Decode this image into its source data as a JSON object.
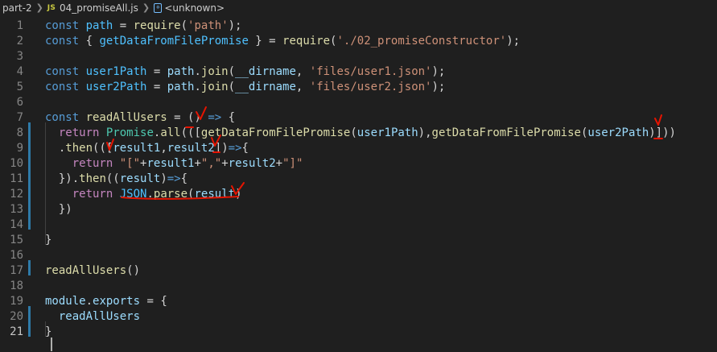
{
  "breadcrumb": {
    "folder": "part-2",
    "file_badge": "JS",
    "file": "04_promiseAll.js",
    "symbol": "<unknown>",
    "symbol_icon": "symbol-object-icon",
    "file_icon": "javascript-file-icon"
  },
  "colors": {
    "background": "#1f1f1f",
    "keyword": "#569cd6",
    "control": "#c586c0",
    "variable": "#9cdcfe",
    "function": "#dcdcaa",
    "string": "#ce9178",
    "class": "#4ec9b0",
    "annotation": "#e51400",
    "modified_bar": "#2e7aa8"
  },
  "editor": {
    "active_line": 21,
    "lines": [
      {
        "n": "1",
        "tokens": [
          [
            "kw",
            "const "
          ],
          [
            "const",
            "path"
          ],
          [
            "pl",
            " = "
          ],
          [
            "fn",
            "require"
          ],
          [
            "pl",
            "("
          ],
          [
            "str",
            "'path'"
          ],
          [
            "pl",
            ");"
          ]
        ]
      },
      {
        "n": "2",
        "tokens": [
          [
            "kw",
            "const "
          ],
          [
            "pl",
            "{ "
          ],
          [
            "const",
            "getDataFromFilePromise"
          ],
          [
            "pl",
            " } = "
          ],
          [
            "fn",
            "require"
          ],
          [
            "pl",
            "("
          ],
          [
            "str",
            "'./02_promiseConstructor'"
          ],
          [
            "pl",
            ");"
          ]
        ]
      },
      {
        "n": "3",
        "tokens": []
      },
      {
        "n": "4",
        "tokens": [
          [
            "kw",
            "const "
          ],
          [
            "const",
            "user1Path"
          ],
          [
            "pl",
            " = "
          ],
          [
            "var",
            "path"
          ],
          [
            "pl",
            "."
          ],
          [
            "fn",
            "join"
          ],
          [
            "pl",
            "("
          ],
          [
            "var",
            "__dirname"
          ],
          [
            "pl",
            ", "
          ],
          [
            "str",
            "'files/user1.json'"
          ],
          [
            "pl",
            ");"
          ]
        ]
      },
      {
        "n": "5",
        "tokens": [
          [
            "kw",
            "const "
          ],
          [
            "const",
            "user2Path"
          ],
          [
            "pl",
            " = "
          ],
          [
            "var",
            "path"
          ],
          [
            "pl",
            "."
          ],
          [
            "fn",
            "join"
          ],
          [
            "pl",
            "("
          ],
          [
            "var",
            "__dirname"
          ],
          [
            "pl",
            ", "
          ],
          [
            "str",
            "'files/user2.json'"
          ],
          [
            "pl",
            ");"
          ]
        ]
      },
      {
        "n": "6",
        "tokens": []
      },
      {
        "n": "7",
        "tokens": [
          [
            "kw",
            "const "
          ],
          [
            "fn",
            "readAllUsers"
          ],
          [
            "pl",
            " = () "
          ],
          [
            "kw",
            "=>"
          ],
          [
            "pl",
            " {"
          ]
        ]
      },
      {
        "n": "8",
        "tokens": [
          [
            "pl",
            "  "
          ],
          [
            "ctl",
            "return "
          ],
          [
            "cls",
            "Promise"
          ],
          [
            "pl",
            "."
          ],
          [
            "fn",
            "all"
          ],
          [
            "pl",
            "((["
          ],
          [
            "fn",
            "getDataFromFilePromise"
          ],
          [
            "pl",
            "("
          ],
          [
            "var",
            "user1Path"
          ],
          [
            "pl",
            "),"
          ],
          [
            "fn",
            "getDataFromFilePromise"
          ],
          [
            "pl",
            "("
          ],
          [
            "var",
            "user2Path"
          ],
          [
            "pl",
            ")]))"
          ]
        ]
      },
      {
        "n": "9",
        "tokens": [
          [
            "pl",
            "  ."
          ],
          [
            "fn",
            "then"
          ],
          [
            "pl",
            "((["
          ],
          [
            "var",
            "result1"
          ],
          [
            "pl",
            ","
          ],
          [
            "var",
            "result2"
          ],
          [
            "pl",
            "])"
          ],
          [
            "kw",
            "=>"
          ],
          [
            "pl",
            "{"
          ]
        ]
      },
      {
        "n": "10",
        "tokens": [
          [
            "pl",
            "    "
          ],
          [
            "ctl",
            "return "
          ],
          [
            "str",
            "\"[\""
          ],
          [
            "pl",
            "+"
          ],
          [
            "var",
            "result1"
          ],
          [
            "pl",
            "+"
          ],
          [
            "str",
            "\",\""
          ],
          [
            "pl",
            "+"
          ],
          [
            "var",
            "result2"
          ],
          [
            "pl",
            "+"
          ],
          [
            "str",
            "\"]\""
          ]
        ]
      },
      {
        "n": "11",
        "tokens": [
          [
            "pl",
            "  })."
          ],
          [
            "fn",
            "then"
          ],
          [
            "pl",
            "(("
          ],
          [
            "var",
            "result"
          ],
          [
            "pl",
            ")"
          ],
          [
            "kw",
            "=>"
          ],
          [
            "pl",
            "{"
          ]
        ]
      },
      {
        "n": "12",
        "tokens": [
          [
            "pl",
            "    "
          ],
          [
            "ctl",
            "return "
          ],
          [
            "const",
            "JSON"
          ],
          [
            "pl",
            "."
          ],
          [
            "fn",
            "parse"
          ],
          [
            "pl",
            "("
          ],
          [
            "var",
            "result"
          ],
          [
            "pl",
            ")"
          ]
        ]
      },
      {
        "n": "13",
        "tokens": [
          [
            "pl",
            "  })"
          ]
        ]
      },
      {
        "n": "14",
        "tokens": []
      },
      {
        "n": "15",
        "tokens": [
          [
            "pl",
            "}"
          ]
        ]
      },
      {
        "n": "16",
        "tokens": []
      },
      {
        "n": "17",
        "tokens": [
          [
            "fn",
            "readAllUsers"
          ],
          [
            "pl",
            "()"
          ]
        ]
      },
      {
        "n": "18",
        "tokens": []
      },
      {
        "n": "19",
        "tokens": [
          [
            "var",
            "module"
          ],
          [
            "pl",
            "."
          ],
          [
            "var",
            "exports"
          ],
          [
            "pl",
            " = {"
          ]
        ]
      },
      {
        "n": "20",
        "tokens": [
          [
            "pl",
            "  "
          ],
          [
            "var",
            "readAllUsers"
          ]
        ]
      },
      {
        "n": "21",
        "tokens": [
          [
            "pl",
            "}"
          ]
        ]
      }
    ]
  }
}
